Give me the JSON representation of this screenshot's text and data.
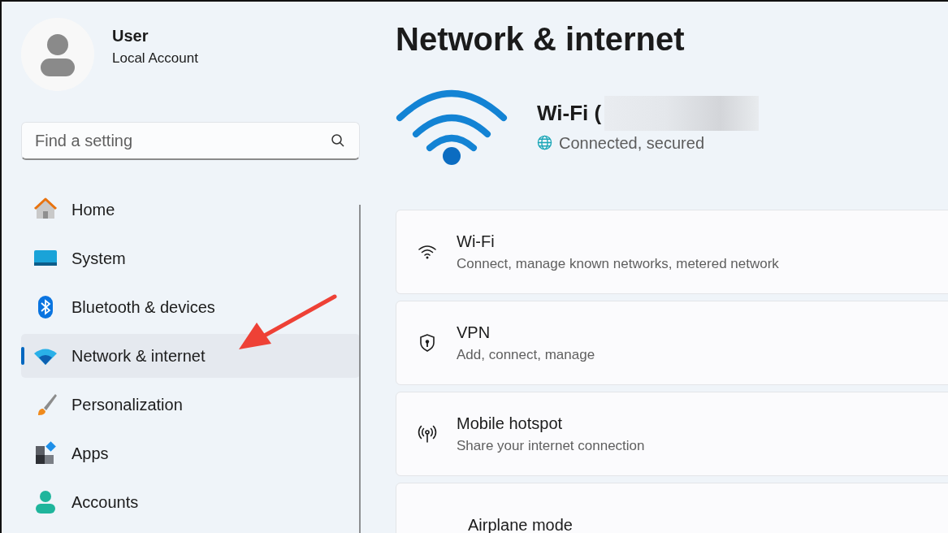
{
  "user": {
    "name": "User",
    "account": "Local Account"
  },
  "search": {
    "placeholder": "Find a setting"
  },
  "nav": [
    {
      "label": "Home",
      "selected": false
    },
    {
      "label": "System",
      "selected": false
    },
    {
      "label": "Bluetooth & devices",
      "selected": false
    },
    {
      "label": "Network & internet",
      "selected": true
    },
    {
      "label": "Personalization",
      "selected": false
    },
    {
      "label": "Apps",
      "selected": false
    },
    {
      "label": "Accounts",
      "selected": false
    }
  ],
  "page_title": "Network & internet",
  "connection": {
    "name": "Wi-Fi (",
    "status": "Connected, secured"
  },
  "settings": [
    {
      "title": "Wi-Fi",
      "description": "Connect, manage known networks, metered network"
    },
    {
      "title": "VPN",
      "description": "Add, connect, manage"
    },
    {
      "title": "Mobile hotspot",
      "description": "Share your internet connection"
    },
    {
      "title": "Airplane mode"
    }
  ]
}
